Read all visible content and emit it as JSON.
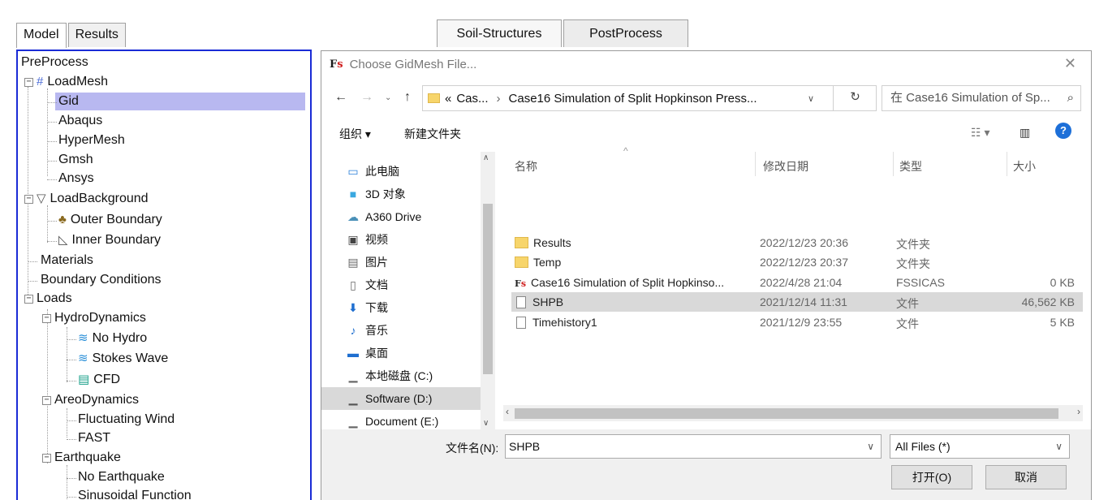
{
  "left_tabs": [
    "Model",
    "Results"
  ],
  "center_tabs": [
    "Soil-Structures",
    "PostProcess"
  ],
  "tree": {
    "items": [
      {
        "label": "PreProcess"
      },
      {
        "label": "LoadMesh",
        "icon": "mesh-grid-icon"
      },
      {
        "label": "Gid"
      },
      {
        "label": "Abaqus"
      },
      {
        "label": "HyperMesh"
      },
      {
        "label": "Gmsh"
      },
      {
        "label": "Ansys"
      },
      {
        "label": "LoadBackground",
        "icon": "background-icon"
      },
      {
        "label": "Outer Boundary",
        "icon": "boundary-icon"
      },
      {
        "label": "Inner Boundary",
        "icon": "inner-boundary-icon"
      },
      {
        "label": "Materials"
      },
      {
        "label": "Boundary Conditions"
      },
      {
        "label": "Loads"
      },
      {
        "label": "HydroDynamics"
      },
      {
        "label": "No Hydro",
        "icon": "no-hydro-icon"
      },
      {
        "label": "Stokes Wave",
        "icon": "wave-icon"
      },
      {
        "label": "CFD",
        "icon": "cfd-icon"
      },
      {
        "label": "AreoDynamics"
      },
      {
        "label": "Fluctuating Wind"
      },
      {
        "label": "FAST"
      },
      {
        "label": "Earthquake"
      },
      {
        "label": "No Earthquake"
      },
      {
        "label": "Sinusoidal Function"
      }
    ]
  },
  "dialog": {
    "title": "Choose GidMesh File...",
    "address": {
      "prefix": "«",
      "part1": "Cas...",
      "part2": "Case16 Simulation of Split Hopkinson Press..."
    },
    "search_placeholder": "在 Case16 Simulation of Sp...",
    "toolbar": {
      "organize": "组织 ▾",
      "new_folder": "新建文件夹"
    },
    "nav": [
      {
        "label": "此电脑",
        "icon": "computer-icon"
      },
      {
        "label": "3D 对象",
        "icon": "3d-objects-icon"
      },
      {
        "label": "A360 Drive",
        "icon": "cloud-drive-icon"
      },
      {
        "label": "视频",
        "icon": "video-icon"
      },
      {
        "label": "图片",
        "icon": "pictures-icon"
      },
      {
        "label": "文档",
        "icon": "documents-icon"
      },
      {
        "label": "下载",
        "icon": "download-icon"
      },
      {
        "label": "音乐",
        "icon": "music-icon"
      },
      {
        "label": "桌面",
        "icon": "desktop-icon"
      },
      {
        "label": "本地磁盘 (C:)",
        "icon": "drive-icon"
      },
      {
        "label": "Software (D:)",
        "icon": "drive-icon"
      },
      {
        "label": "Document (E:)",
        "icon": "drive-icon"
      }
    ],
    "columns": {
      "name": "名称",
      "date": "修改日期",
      "type": "类型",
      "size": "大小"
    },
    "files": [
      {
        "name": "Results",
        "date": "2022/12/23 20:36",
        "type": "文件夹",
        "size": "",
        "icon": "folder-icon"
      },
      {
        "name": "Temp",
        "date": "2022/12/23 20:37",
        "type": "文件夹",
        "size": "",
        "icon": "folder-icon"
      },
      {
        "name": "Case16 Simulation of Split Hopkinso...",
        "date": "2022/4/28 21:04",
        "type": "FSSICAS",
        "size": "0 KB",
        "icon": "fssicas-file-icon"
      },
      {
        "name": "SHPB",
        "date": "2021/12/14 11:31",
        "type": "文件",
        "size": "46,562 KB",
        "icon": "file-icon"
      },
      {
        "name": "Timehistory1",
        "date": "2021/12/9 23:55",
        "type": "文件",
        "size": "5 KB",
        "icon": "file-icon"
      }
    ],
    "filename_label": "文件名(N):",
    "filename_value": "SHPB",
    "filetype_value": "All Files (*)",
    "open_label": "打开(O)",
    "cancel_label": "取消"
  }
}
